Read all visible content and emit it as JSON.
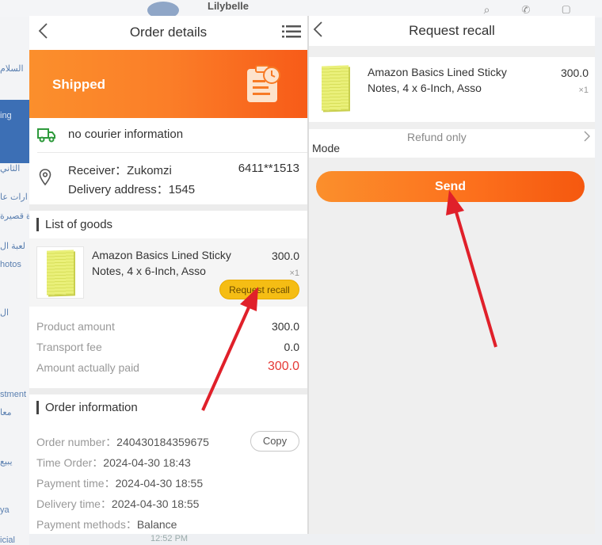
{
  "background": {
    "contact_name": "Lilybelle",
    "sidebar_texts": [
      "السلام",
      "ing",
      "الثاني",
      "ارات عا",
      "ة قصيرة",
      "لعبة ال",
      "hotos",
      "ال",
      "stment",
      "معا",
      "يبيع",
      "ya",
      "icial"
    ],
    "bottom_text": "12:52 PM"
  },
  "order": {
    "header_title": "Order details",
    "status": "Shipped",
    "courier_text": "no courier information",
    "receiver": "Receiver：Zukomzi",
    "phone": "6411**1513",
    "address": "Delivery address：1545",
    "goods_section_title": "List of goods",
    "goods": {
      "name_line1": "Amazon Basics Lined Sticky",
      "name_line2": "Notes, 4 x 6-Inch, Asso",
      "price": "300.0",
      "qty": "×1",
      "recall_label": "Request recall"
    },
    "amounts": [
      {
        "label": "Product amount",
        "value": "300.0"
      },
      {
        "label": "Transport fee",
        "value": "0.0"
      },
      {
        "label": "Amount actually paid",
        "value": "300.0"
      }
    ],
    "info_section_title": "Order information",
    "info": [
      {
        "label": "Order number：",
        "value": "240430184359675"
      },
      {
        "label": "Time Order：",
        "value": "2024-04-30 18:43"
      },
      {
        "label": "Payment time：",
        "value": "2024-04-30 18:55"
      },
      {
        "label": "Delivery time：",
        "value": "2024-04-30 18:55"
      },
      {
        "label": "Payment methods：",
        "value": "Balance"
      }
    ],
    "copy_label": "Copy"
  },
  "recall": {
    "header_title": "Request recall",
    "goods": {
      "name_line1": "Amazon Basics Lined Sticky",
      "name_line2": "Notes, 4 x 6-Inch, Asso",
      "price": "300.0",
      "qty": "×1"
    },
    "refund_text": "Refund only",
    "mode_label": "Mode",
    "send_label": "Send"
  },
  "colors": {
    "accent_orange": "#fb7e28",
    "recall_yellow": "#f5bd14",
    "price_red": "#e53935",
    "arrow_red": "#e0202a"
  }
}
